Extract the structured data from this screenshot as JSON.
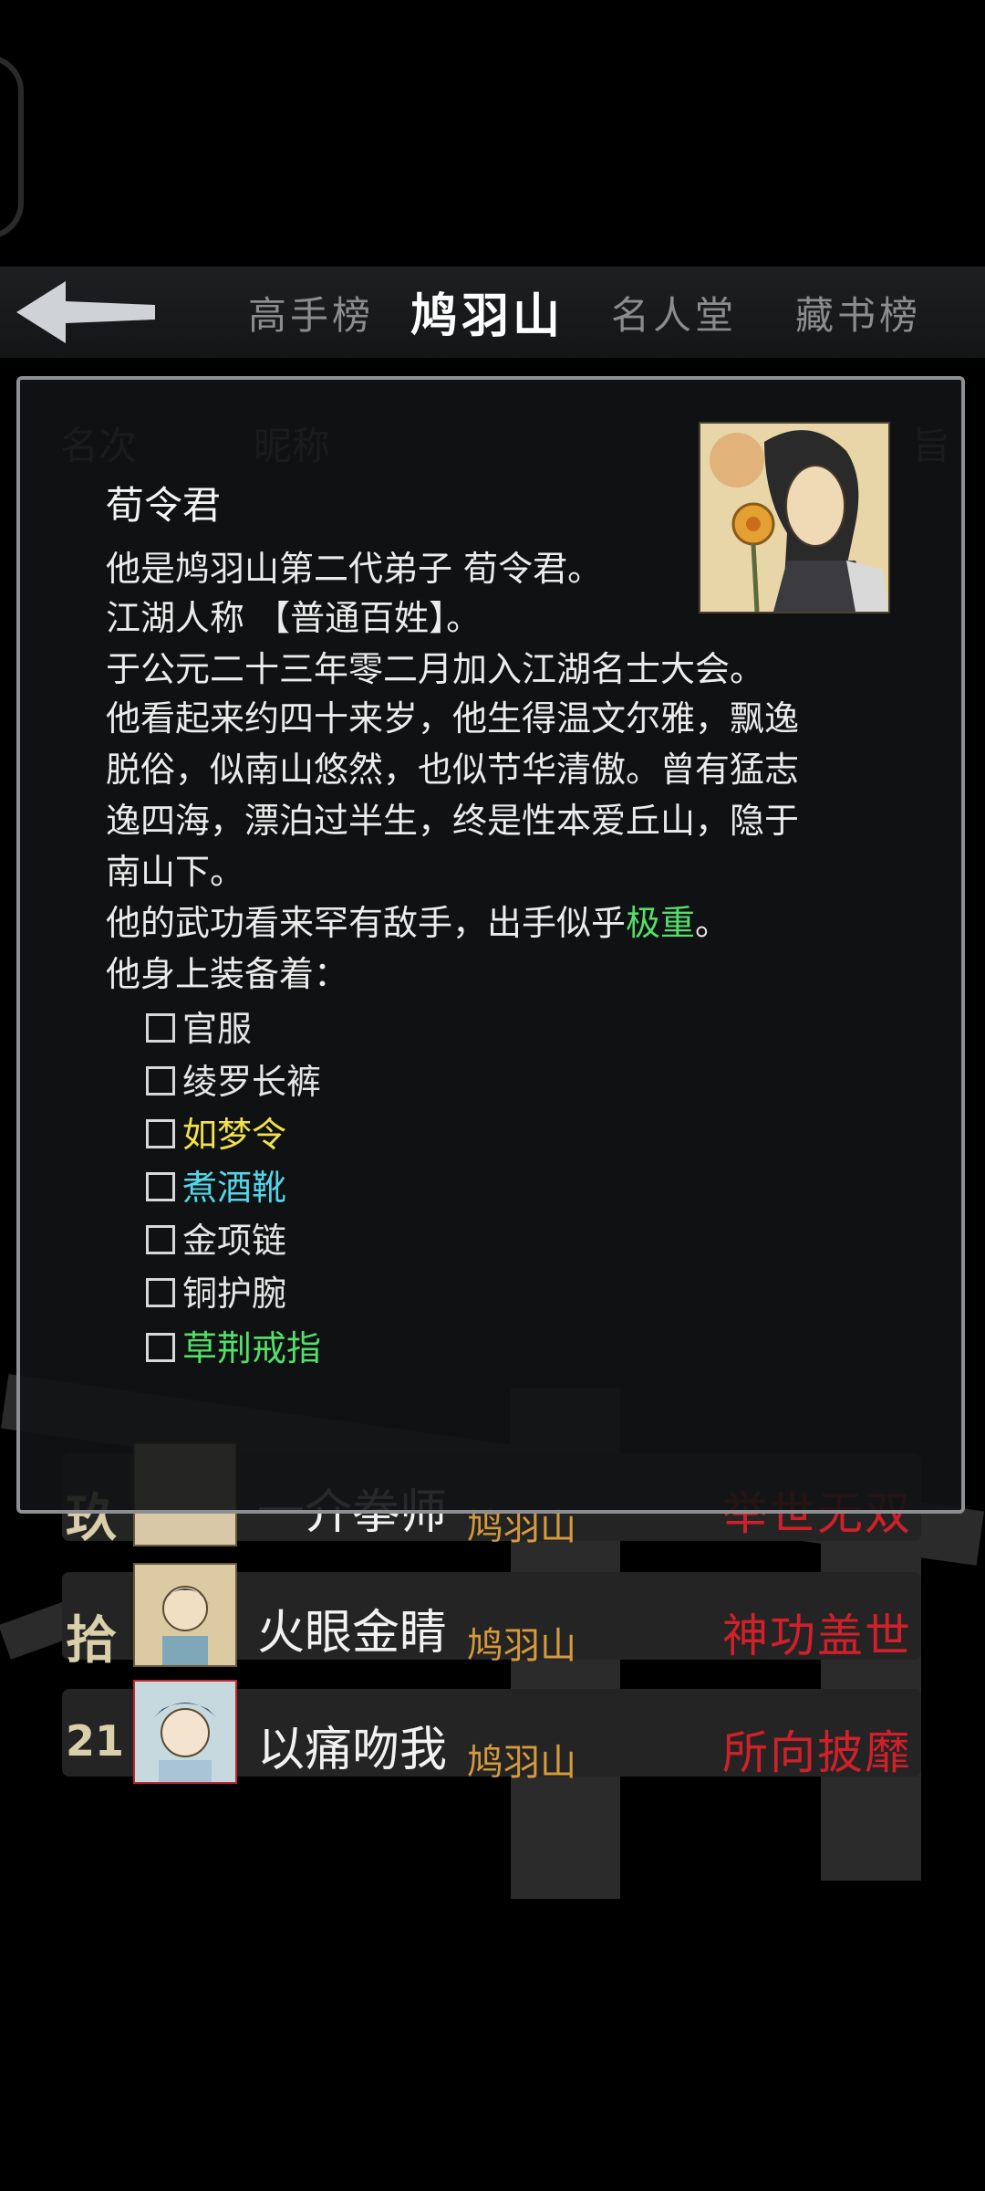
{
  "tabs": [
    {
      "label": "高手榜"
    },
    {
      "label": "鸠羽山"
    },
    {
      "label": "名人堂"
    },
    {
      "label": "藏书榜"
    }
  ],
  "list": {
    "header": {
      "rank": "名次",
      "nickname": "昵称",
      "tail": "旨"
    },
    "rows": [
      {
        "rank": "玖",
        "name": "一介拳师",
        "sect": "鸠羽山",
        "title": "举世无双"
      },
      {
        "rank": "拾",
        "name": "火眼金睛",
        "sect": "鸠羽山",
        "title": "神功盖世"
      },
      {
        "rank": "21",
        "name": "以痛吻我",
        "sect": "鸠羽山",
        "title": "所向披靡"
      }
    ]
  },
  "dialog": {
    "name": "荀令君",
    "lines": [
      "他是鸠羽山第二代弟子 荀令君。",
      "江湖人称 【普通百姓】。",
      "于公元二十三年零二月加入江湖名士大会。",
      "他看起来约四十来岁，他生得温文尔雅，飘逸",
      "脱俗，似南山悠然，也似节华清傲。曾有猛志",
      "逸四海，漂泊过半生，终是性本爱丘山，隐于",
      "南山下。"
    ],
    "martial_prefix": "他的武功看来罕有敌手，出手似乎",
    "martial_level": "极重",
    "martial_suffix": "。",
    "equip_intro": "他身上装备着：",
    "equipment": [
      {
        "name": "官服",
        "color": "#e6e6e6"
      },
      {
        "name": "绫罗长裤",
        "color": "#e6e6e6"
      },
      {
        "name": "如梦令",
        "color": "#f1e24a"
      },
      {
        "name": "煮酒靴",
        "color": "#53d6e8"
      },
      {
        "name": "金项链",
        "color": "#e6e6e6"
      },
      {
        "name": "铜护腕",
        "color": "#e6e6e6"
      },
      {
        "name": "草荆戒指",
        "color": "#52df6a"
      }
    ],
    "highlight_color": "#52df6a"
  }
}
